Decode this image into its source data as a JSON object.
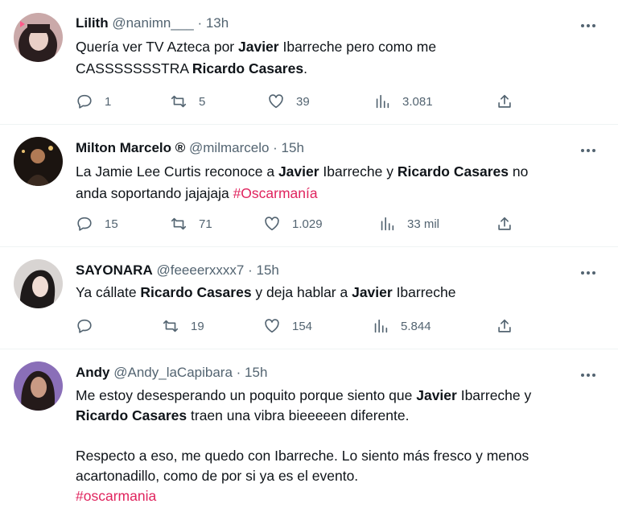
{
  "tweets": [
    {
      "name": "Lilith",
      "handle": "@nanimn___",
      "sep": " · ",
      "time": "13h",
      "lines": [
        [
          {
            "t": "Quería ver TV Azteca por "
          },
          {
            "t": "Javier",
            "b": true
          },
          {
            "t": " Ibarreche pero como me"
          }
        ],
        [
          {
            "t": "CASSSSSSSTRA "
          },
          {
            "t": "Ricardo Casares",
            "b": true
          },
          {
            "t": "."
          }
        ]
      ],
      "replies": "1",
      "retweets": "5",
      "likes": "39",
      "views": "3.081"
    },
    {
      "name": "Milton Marcelo ®",
      "handle": "@milmarcelo",
      "sep": " · ",
      "time": "15h",
      "lines": [
        [
          {
            "t": "La Jamie Lee Curtis reconoce a "
          },
          {
            "t": "Javier",
            "b": true
          },
          {
            "t": " Ibarreche y "
          },
          {
            "t": "Ricardo Casares",
            "b": true
          },
          {
            "t": " no"
          }
        ],
        [
          {
            "t": "anda soportando jajajaja "
          },
          {
            "t": "#Oscarmanía",
            "tag": true
          }
        ]
      ],
      "replies": "15",
      "retweets": "71",
      "likes": "1.029",
      "views": "33 mil"
    },
    {
      "name": "SAYONARA",
      "handle": "@feeeerxxxx7",
      "sep": " · ",
      "time": "15h",
      "lines": [
        [
          {
            "t": "Ya cállate "
          },
          {
            "t": "Ricardo Casares",
            "b": true
          },
          {
            "t": " y deja hablar a "
          },
          {
            "t": "Javier",
            "b": true
          },
          {
            "t": " Ibarreche"
          }
        ]
      ],
      "replies": "",
      "retweets": "19",
      "likes": "154",
      "views": "5.844"
    },
    {
      "name": "Andy",
      "handle": "@Andy_laCapibara",
      "sep": " · ",
      "time": "15h",
      "lines": [
        [
          {
            "t": "Me estoy desesperando un poquito porque siento que "
          },
          {
            "t": "Javier",
            "b": true
          },
          {
            "t": " Ibarreche y"
          }
        ],
        [
          {
            "t": "Ricardo Casares",
            "b": true
          },
          {
            "t": " traen una vibra bieeeeen diferente."
          }
        ],
        [],
        [
          {
            "t": "Respecto a eso, me quedo con Ibarreche. Lo siento más fresco y menos"
          }
        ],
        [
          {
            "t": "acartonadillo, como de por si ya es el evento."
          }
        ],
        [
          {
            "t": "#oscarmania",
            "tag": true
          }
        ]
      ]
    }
  ],
  "colors": {
    "text": "#0f1419",
    "muted": "#536471",
    "hashtag": "#e0245e",
    "border": "#eff3f4"
  },
  "icons": [
    "reply-icon",
    "retweet-icon",
    "like-icon",
    "views-icon",
    "share-icon",
    "more-icon"
  ]
}
